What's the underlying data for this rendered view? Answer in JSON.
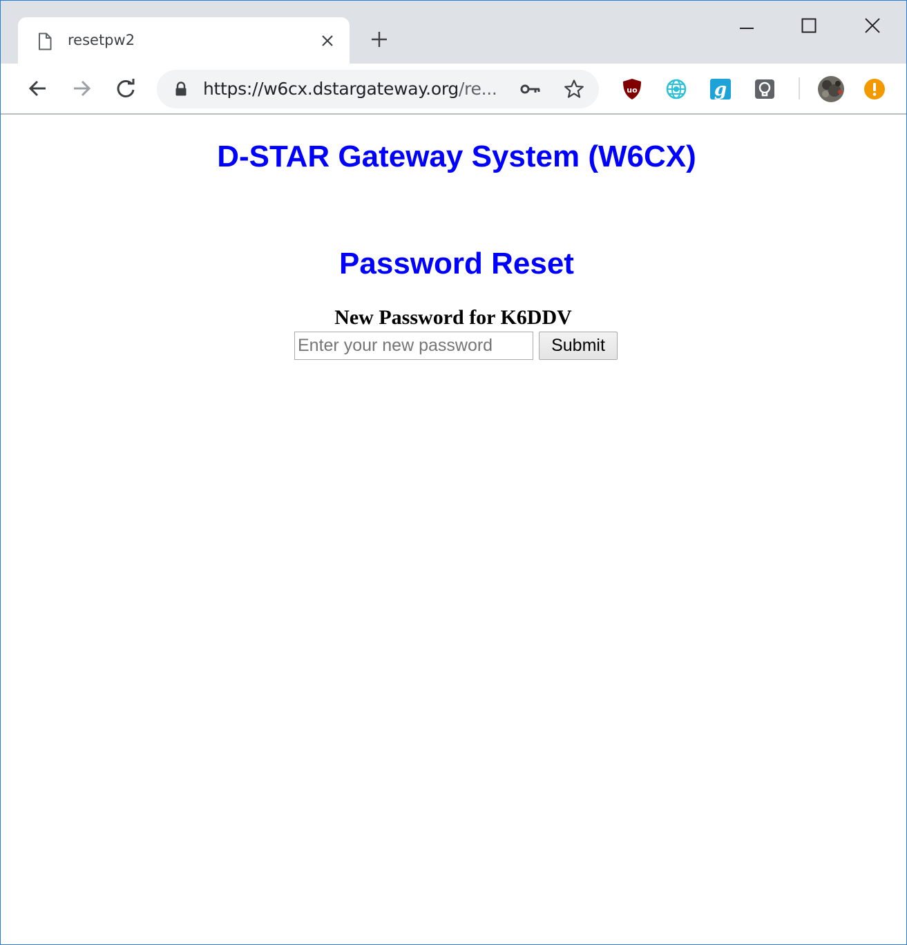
{
  "browser": {
    "tab": {
      "title": "resetpw2",
      "icon": "document-icon"
    },
    "window_controls": [
      "minimize",
      "maximize",
      "close"
    ],
    "omnibox": {
      "url_host": "https://w6cx.dstargateway.org",
      "url_rest": "/re...",
      "secure": true
    },
    "extensions": [
      "ublock-origin-icon",
      "network-globe-icon",
      "grammarly-icon",
      "bulb-icon",
      "profile-avatar",
      "update-alert-icon"
    ]
  },
  "colors": {
    "heading": "#0000ff",
    "ublock": "#800000",
    "grammarly": "#15c39a",
    "alert": "#f29900"
  },
  "page": {
    "site_title": "D-STAR Gateway System (W6CX)",
    "heading": "Password Reset",
    "form": {
      "label": "New Password for K6DDV",
      "password_placeholder": "Enter your new password",
      "submit_label": "Submit"
    }
  }
}
